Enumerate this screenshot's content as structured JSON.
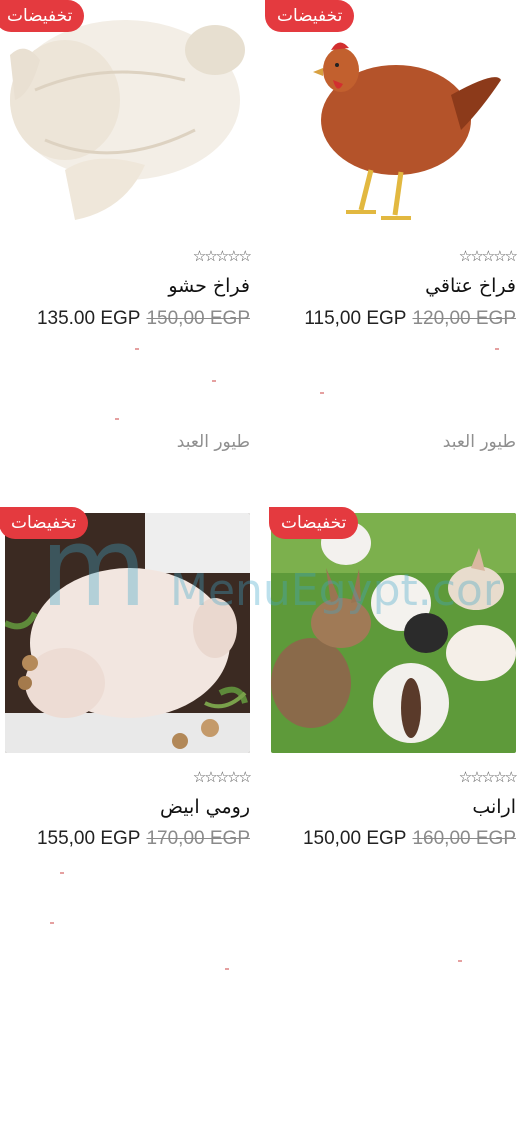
{
  "badge_label": "تخفيضات",
  "products": [
    {
      "name": "فراخ عتاقي",
      "price_new": "115,00 EGP",
      "price_old": "120,00 EGP",
      "rating_stars": "☆☆☆☆☆",
      "vendor": "طيور العبد",
      "image": "red-hen"
    },
    {
      "name": "فراخ حشو",
      "price_new": "135.00 EGP",
      "price_old": "150,00 EGP",
      "rating_stars": "☆☆☆☆☆",
      "vendor": "طيور العبد",
      "image": "raw-chicken"
    },
    {
      "name": "ارانب",
      "price_new": "150,00 EGP",
      "price_old": "160,00 EGP",
      "rating_stars": "☆☆☆☆☆",
      "image": "rabbits"
    },
    {
      "name": "رومي ابيض",
      "price_new": "155,00 EGP",
      "price_old": "170,00 EGP",
      "rating_stars": "☆☆☆☆☆",
      "image": "raw-turkey"
    }
  ],
  "watermark": "MenuEgypt.com",
  "colors": {
    "badge": "#e43a3f",
    "old_price": "#8a8a8a",
    "vendor": "#8f8f8f"
  }
}
